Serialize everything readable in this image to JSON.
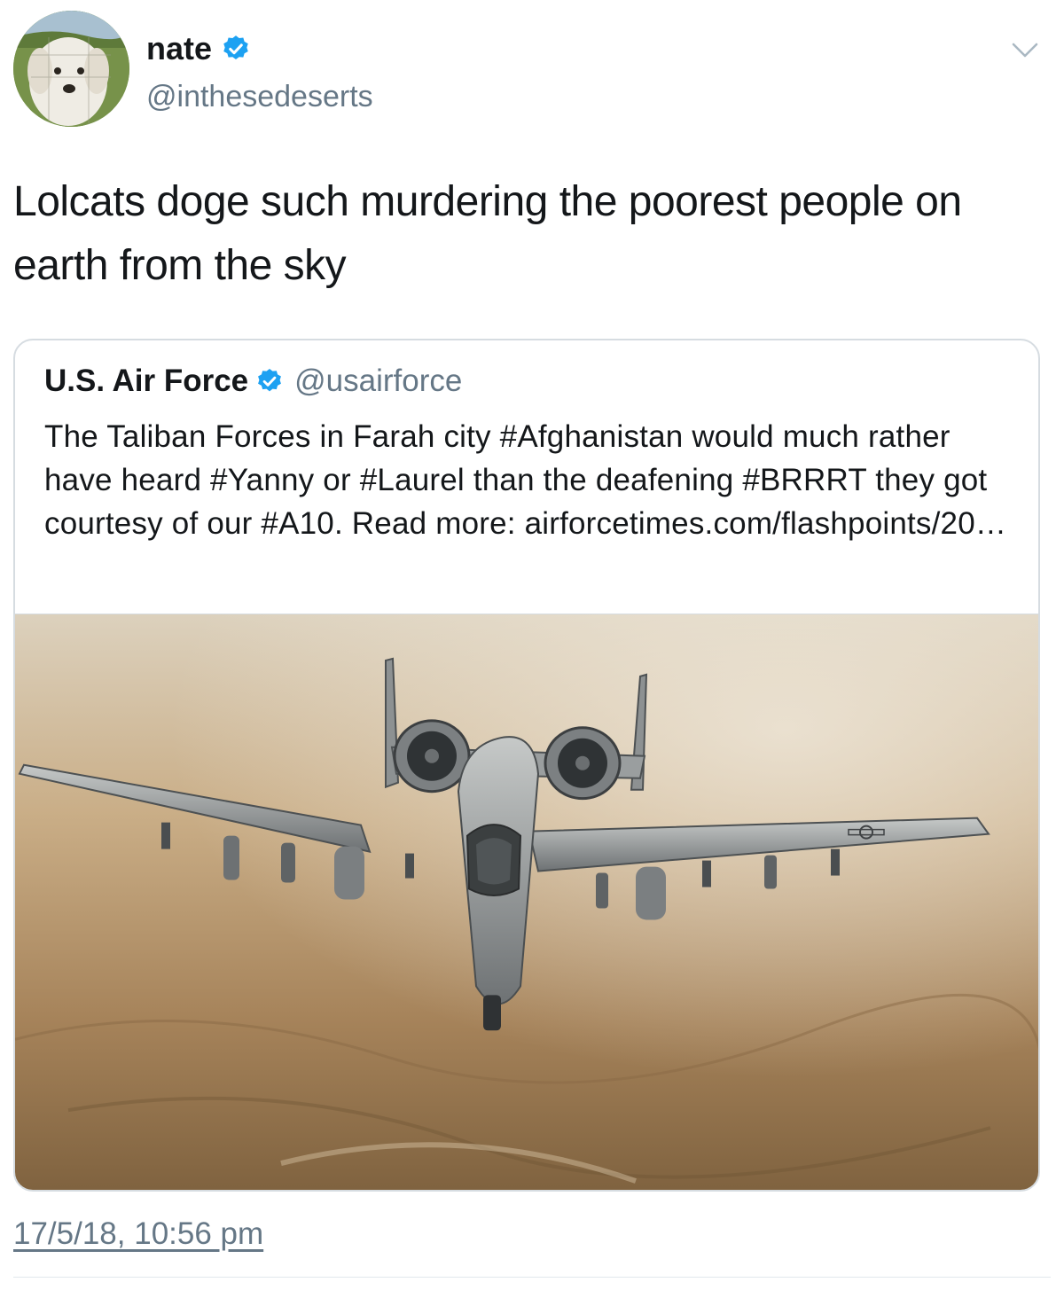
{
  "author": {
    "display_name": "nate",
    "handle": "@inthesedeserts",
    "verified": true
  },
  "tweet": {
    "text": "Lolcats doge such murdering the poorest people on earth from the sky",
    "timestamp": "17/5/18, 10:56 pm"
  },
  "quoted_tweet": {
    "display_name": "U.S. Air Force",
    "handle": "@usairforce",
    "verified": true,
    "text": "The Taliban Forces in Farah city #Afghanistan would much rather have heard #Yanny or #Laurel than the deafening #BRRRT they got courtesy of our #A10. Read more: airforcetimes.com/flashpoints/20…",
    "media": "a10-aircraft-photo"
  },
  "icons": {
    "verified": "verified-badge-icon",
    "more": "chevron-down-icon"
  },
  "colors": {
    "verified_blue": "#1da1f2",
    "secondary_text": "#657786",
    "border": "#d6dce1"
  }
}
